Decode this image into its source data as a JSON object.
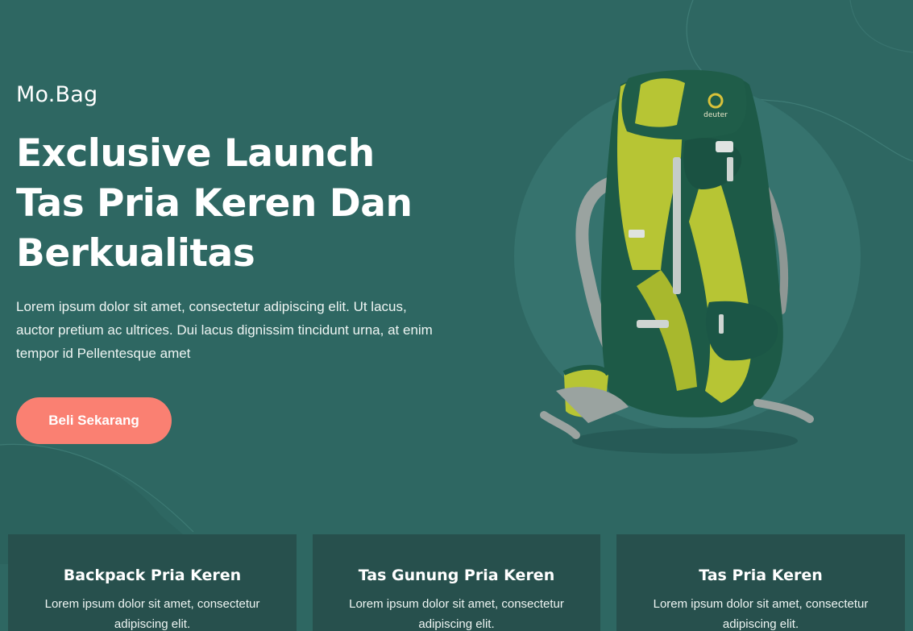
{
  "header": {
    "brand": "Mo.Bag"
  },
  "hero": {
    "headline_lines": [
      "Exclusive Launch",
      "Tas Pria Keren Dan",
      "Berkualitas"
    ],
    "description": "Lorem ipsum dolor sit amet, consectetur adipiscing elit. Ut lacus, auctor pretium ac ultrices. Dui lacus dignissim tincidunt urna, at enim tempor id Pellentesque amet",
    "cta_label": "Beli Sekarang",
    "product_brand": "deuter",
    "product_image_name": "backpack-image"
  },
  "colors": {
    "background": "#2e6762",
    "circle": "#36736e",
    "card": "#27504d",
    "cta": "#fa8072"
  },
  "features": [
    {
      "title": "Backpack Pria Keren",
      "description": "Lorem ipsum dolor sit amet, consectetur adipiscing elit."
    },
    {
      "title": "Tas Gunung Pria Keren",
      "description": "Lorem ipsum dolor sit amet, consectetur adipiscing elit."
    },
    {
      "title": "Tas Pria Keren",
      "description": "Lorem ipsum dolor sit amet, consectetur adipiscing elit."
    }
  ]
}
